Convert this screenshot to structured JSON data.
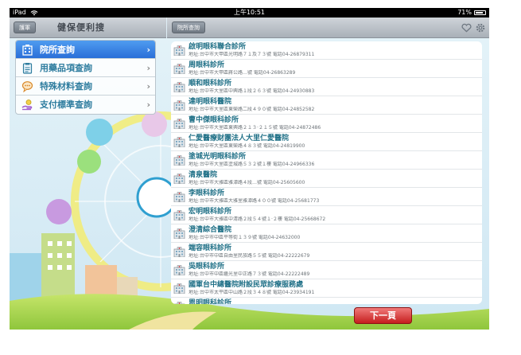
{
  "statusbar": {
    "device": "iPad",
    "time": "上午10:51",
    "battery": "71%"
  },
  "nav_left": {
    "back_label": "護軍",
    "title": "健保便利搜"
  },
  "nav_right": {
    "back_label": "院所查詢"
  },
  "menu": {
    "items": [
      {
        "label": "院所查詢",
        "icon": "building-icon"
      },
      {
        "label": "用藥品項查詢",
        "icon": "clipboard-icon"
      },
      {
        "label": "特殊材料查詢",
        "icon": "chat-bubble-icon"
      },
      {
        "label": "支付標準查詢",
        "icon": "hand-coin-icon"
      }
    ]
  },
  "results": [
    {
      "name": "啟明眼科聯合診所",
      "address": "地址:台中市大甲區光明路７１及７３號 電話04-26879311"
    },
    {
      "name": "周眼科診所",
      "address": "地址:台中市大甲區蔣公路…號 電話04-26863289"
    },
    {
      "name": "順和眼科診所",
      "address": "地址:台中市大里區中興路１段２６３號 電話04-24930883"
    },
    {
      "name": "達明眼科醫院",
      "address": "地址:台中市大里區東榮路二段４９０號 電話04-24852582"
    },
    {
      "name": "曹中傑眼科診所",
      "address": "地址:台中市大里區東興路２１３‧２１５號 電話04-24872486"
    },
    {
      "name": "仁愛醫療財團法人大里仁愛醫院",
      "address": "地址:台中市大里區東榮路４８３號 電話04-24819900"
    },
    {
      "name": "塗城光明眼科診所",
      "address": "地址:台中市大里區塗城路５３２號１樓 電話04-24966336"
    },
    {
      "name": "清泉醫院",
      "address": "地址:台中市大雅區雅潭路４段…號 電話04-25605600"
    },
    {
      "name": "李眼科診所",
      "address": "地址:台中市大雅區大雅里雅潭路４００號 電話04-25681773"
    },
    {
      "name": "宏明眼科診所",
      "address": "地址:台中市大雅區中清路２段５４號１‧２樓 電話04-25668672"
    },
    {
      "name": "澄清綜合醫院",
      "address": "地址:台中市中區平等街１３９號 電話04-24632000"
    },
    {
      "name": "端容眼科診所",
      "address": "地址:台中市中區自由里民族路５５號 電話04-22222679"
    },
    {
      "name": "吳眼科診所",
      "address": "地址:台中市中區繼光里中正路７３號 電話04-22222489"
    },
    {
      "name": "國軍台中總醫院附設民眾診療服務處",
      "address": "地址:台中市太平區中山路２段３４８號 電話04-23934191"
    },
    {
      "name": "恩明眼科診所",
      "address": ""
    }
  ],
  "pagination": {
    "next_label": "下一頁"
  },
  "colors": {
    "accent": "#2a6fd8",
    "link": "#1e6f86",
    "next": "#c51e1e"
  }
}
